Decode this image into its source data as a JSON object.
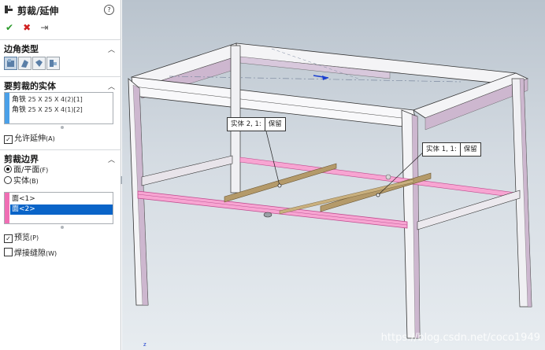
{
  "panel": {
    "title": "剪裁/延伸",
    "help_icon": "?",
    "actions": {
      "ok": "✔",
      "cancel": "✖",
      "pin": "⇥"
    },
    "corner_type": {
      "label": "边角类型",
      "buttons": [
        "end-trim-icon",
        "end-miter-icon",
        "end-butt-icon",
        "end-butt2-icon"
      ]
    },
    "bodies_to_trim": {
      "label": "要剪裁的实体",
      "items": [
        {
          "name": "角铁",
          "spec": " 25 X 25 X 4(2)[1]"
        },
        {
          "name": "角铁",
          "spec": " 25 X 25 X 4(1)[2]"
        }
      ]
    },
    "allow_extend": {
      "label": "允许延伸",
      "shortcut": "(A)",
      "checked": true
    },
    "trim_boundary": {
      "label": "剪裁边界",
      "option_face": {
        "label": "面/平面",
        "shortcut": "(F)",
        "selected": true
      },
      "option_body": {
        "label": "实体",
        "shortcut": "(B)",
        "selected": false
      },
      "items": [
        "面<1>",
        "面<2>"
      ],
      "selected_index": 1
    },
    "preview": {
      "label": "预览",
      "shortcut": "(P)",
      "checked": true
    },
    "weld_gap": {
      "label": "焊接缝隙",
      "shortcut": "(W)",
      "checked": false
    }
  },
  "viewport": {
    "callout_1": {
      "key": "实体 2, 1:",
      "value": "保留"
    },
    "callout_2": {
      "key": "实体 1, 1:",
      "value": "保留"
    },
    "watermark": "https://blog.csdn.net/coco1949",
    "axis_mark": "z"
  },
  "colors": {
    "accent_blue": "#0a64c8",
    "bodies_bar": "#4aa0e8",
    "boundary_bar": "#f06eb4",
    "frame_face": "#f4f4f6",
    "frame_shade": "#c9b6cc",
    "trim_body": "#b49a6a",
    "highlight_pink": "#f7a5d2"
  }
}
